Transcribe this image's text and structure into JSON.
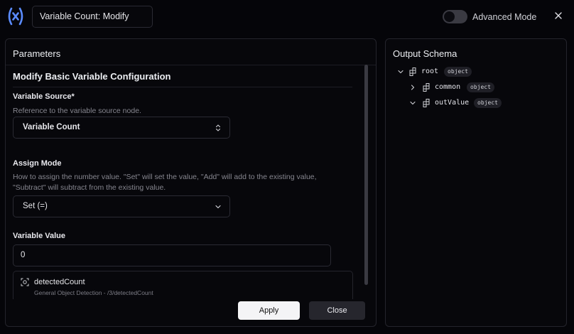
{
  "header": {
    "title_value": "Variable Count: Modify",
    "advanced_mode_label": "Advanced Mode",
    "advanced_mode_on": false,
    "accent_color": "#5b8cff"
  },
  "params": {
    "panel_title": "Parameters",
    "section_title": "Modify Basic Variable Configuration",
    "variable_source": {
      "label": "Variable Source*",
      "description": "Reference to the variable source node.",
      "value": "Variable Count"
    },
    "assign_mode": {
      "label": "Assign Mode",
      "description": "How to assign the number value. \"Set\" will set the value, \"Add\" will add to the existing value, \"Subtract\" will subtract from the existing value.",
      "value": "Set (=)"
    },
    "variable_value": {
      "label": "Variable Value",
      "value": "0"
    },
    "suggestion": {
      "name": "detectedCount",
      "path": "General Object Detection - /3/detectedCount"
    }
  },
  "actions": {
    "apply_label": "Apply",
    "close_label": "Close"
  },
  "output": {
    "panel_title": "Output Schema",
    "tree": [
      {
        "name": "root",
        "type": "object",
        "expanded": true,
        "depth": 0
      },
      {
        "name": "common",
        "type": "object",
        "expanded": false,
        "depth": 1
      },
      {
        "name": "outValue",
        "type": "object",
        "expanded": true,
        "depth": 1
      }
    ]
  }
}
